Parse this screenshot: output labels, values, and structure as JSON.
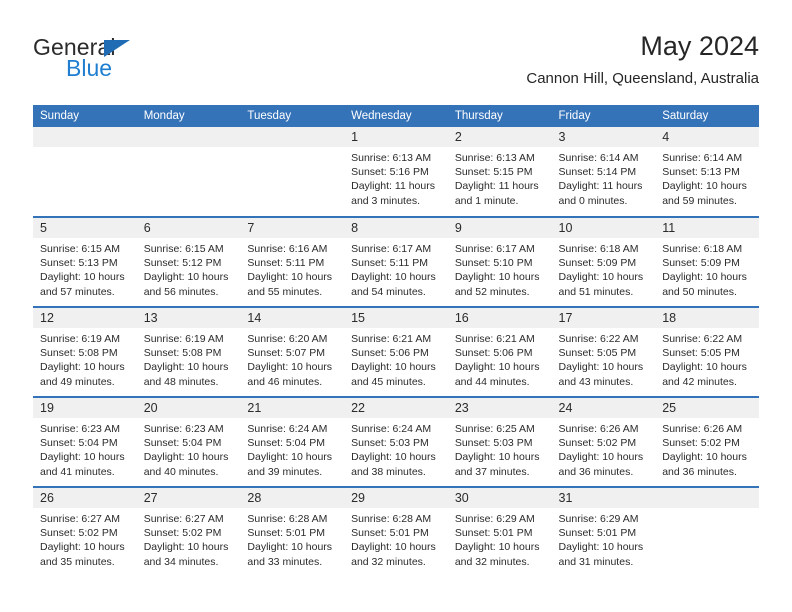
{
  "brand": {
    "name_top": "General",
    "name_bottom": "Blue"
  },
  "header": {
    "title": "May 2024",
    "subtitle": "Cannon Hill, Queensland, Australia"
  },
  "colors": {
    "header_blue": "#3573b9",
    "brand_blue": "#1f7ed0",
    "daynum_band": "#f0f0f0"
  },
  "weekday_headers": [
    "Sunday",
    "Monday",
    "Tuesday",
    "Wednesday",
    "Thursday",
    "Friday",
    "Saturday"
  ],
  "calendar_cells": [
    {
      "day": "",
      "sunrise": "",
      "sunset": "",
      "daylight_line1": "",
      "daylight_line2": "",
      "empty": true
    },
    {
      "day": "",
      "sunrise": "",
      "sunset": "",
      "daylight_line1": "",
      "daylight_line2": "",
      "empty": true
    },
    {
      "day": "",
      "sunrise": "",
      "sunset": "",
      "daylight_line1": "",
      "daylight_line2": "",
      "empty": true
    },
    {
      "day": "1",
      "sunrise": "Sunrise: 6:13 AM",
      "sunset": "Sunset: 5:16 PM",
      "daylight_line1": "Daylight: 11 hours",
      "daylight_line2": "and 3 minutes.",
      "empty": false
    },
    {
      "day": "2",
      "sunrise": "Sunrise: 6:13 AM",
      "sunset": "Sunset: 5:15 PM",
      "daylight_line1": "Daylight: 11 hours",
      "daylight_line2": "and 1 minute.",
      "empty": false
    },
    {
      "day": "3",
      "sunrise": "Sunrise: 6:14 AM",
      "sunset": "Sunset: 5:14 PM",
      "daylight_line1": "Daylight: 11 hours",
      "daylight_line2": "and 0 minutes.",
      "empty": false
    },
    {
      "day": "4",
      "sunrise": "Sunrise: 6:14 AM",
      "sunset": "Sunset: 5:13 PM",
      "daylight_line1": "Daylight: 10 hours",
      "daylight_line2": "and 59 minutes.",
      "empty": false
    },
    {
      "day": "5",
      "sunrise": "Sunrise: 6:15 AM",
      "sunset": "Sunset: 5:13 PM",
      "daylight_line1": "Daylight: 10 hours",
      "daylight_line2": "and 57 minutes.",
      "empty": false
    },
    {
      "day": "6",
      "sunrise": "Sunrise: 6:15 AM",
      "sunset": "Sunset: 5:12 PM",
      "daylight_line1": "Daylight: 10 hours",
      "daylight_line2": "and 56 minutes.",
      "empty": false
    },
    {
      "day": "7",
      "sunrise": "Sunrise: 6:16 AM",
      "sunset": "Sunset: 5:11 PM",
      "daylight_line1": "Daylight: 10 hours",
      "daylight_line2": "and 55 minutes.",
      "empty": false
    },
    {
      "day": "8",
      "sunrise": "Sunrise: 6:17 AM",
      "sunset": "Sunset: 5:11 PM",
      "daylight_line1": "Daylight: 10 hours",
      "daylight_line2": "and 54 minutes.",
      "empty": false
    },
    {
      "day": "9",
      "sunrise": "Sunrise: 6:17 AM",
      "sunset": "Sunset: 5:10 PM",
      "daylight_line1": "Daylight: 10 hours",
      "daylight_line2": "and 52 minutes.",
      "empty": false
    },
    {
      "day": "10",
      "sunrise": "Sunrise: 6:18 AM",
      "sunset": "Sunset: 5:09 PM",
      "daylight_line1": "Daylight: 10 hours",
      "daylight_line2": "and 51 minutes.",
      "empty": false
    },
    {
      "day": "11",
      "sunrise": "Sunrise: 6:18 AM",
      "sunset": "Sunset: 5:09 PM",
      "daylight_line1": "Daylight: 10 hours",
      "daylight_line2": "and 50 minutes.",
      "empty": false
    },
    {
      "day": "12",
      "sunrise": "Sunrise: 6:19 AM",
      "sunset": "Sunset: 5:08 PM",
      "daylight_line1": "Daylight: 10 hours",
      "daylight_line2": "and 49 minutes.",
      "empty": false
    },
    {
      "day": "13",
      "sunrise": "Sunrise: 6:19 AM",
      "sunset": "Sunset: 5:08 PM",
      "daylight_line1": "Daylight: 10 hours",
      "daylight_line2": "and 48 minutes.",
      "empty": false
    },
    {
      "day": "14",
      "sunrise": "Sunrise: 6:20 AM",
      "sunset": "Sunset: 5:07 PM",
      "daylight_line1": "Daylight: 10 hours",
      "daylight_line2": "and 46 minutes.",
      "empty": false
    },
    {
      "day": "15",
      "sunrise": "Sunrise: 6:21 AM",
      "sunset": "Sunset: 5:06 PM",
      "daylight_line1": "Daylight: 10 hours",
      "daylight_line2": "and 45 minutes.",
      "empty": false
    },
    {
      "day": "16",
      "sunrise": "Sunrise: 6:21 AM",
      "sunset": "Sunset: 5:06 PM",
      "daylight_line1": "Daylight: 10 hours",
      "daylight_line2": "and 44 minutes.",
      "empty": false
    },
    {
      "day": "17",
      "sunrise": "Sunrise: 6:22 AM",
      "sunset": "Sunset: 5:05 PM",
      "daylight_line1": "Daylight: 10 hours",
      "daylight_line2": "and 43 minutes.",
      "empty": false
    },
    {
      "day": "18",
      "sunrise": "Sunrise: 6:22 AM",
      "sunset": "Sunset: 5:05 PM",
      "daylight_line1": "Daylight: 10 hours",
      "daylight_line2": "and 42 minutes.",
      "empty": false
    },
    {
      "day": "19",
      "sunrise": "Sunrise: 6:23 AM",
      "sunset": "Sunset: 5:04 PM",
      "daylight_line1": "Daylight: 10 hours",
      "daylight_line2": "and 41 minutes.",
      "empty": false
    },
    {
      "day": "20",
      "sunrise": "Sunrise: 6:23 AM",
      "sunset": "Sunset: 5:04 PM",
      "daylight_line1": "Daylight: 10 hours",
      "daylight_line2": "and 40 minutes.",
      "empty": false
    },
    {
      "day": "21",
      "sunrise": "Sunrise: 6:24 AM",
      "sunset": "Sunset: 5:04 PM",
      "daylight_line1": "Daylight: 10 hours",
      "daylight_line2": "and 39 minutes.",
      "empty": false
    },
    {
      "day": "22",
      "sunrise": "Sunrise: 6:24 AM",
      "sunset": "Sunset: 5:03 PM",
      "daylight_line1": "Daylight: 10 hours",
      "daylight_line2": "and 38 minutes.",
      "empty": false
    },
    {
      "day": "23",
      "sunrise": "Sunrise: 6:25 AM",
      "sunset": "Sunset: 5:03 PM",
      "daylight_line1": "Daylight: 10 hours",
      "daylight_line2": "and 37 minutes.",
      "empty": false
    },
    {
      "day": "24",
      "sunrise": "Sunrise: 6:26 AM",
      "sunset": "Sunset: 5:02 PM",
      "daylight_line1": "Daylight: 10 hours",
      "daylight_line2": "and 36 minutes.",
      "empty": false
    },
    {
      "day": "25",
      "sunrise": "Sunrise: 6:26 AM",
      "sunset": "Sunset: 5:02 PM",
      "daylight_line1": "Daylight: 10 hours",
      "daylight_line2": "and 36 minutes.",
      "empty": false
    },
    {
      "day": "26",
      "sunrise": "Sunrise: 6:27 AM",
      "sunset": "Sunset: 5:02 PM",
      "daylight_line1": "Daylight: 10 hours",
      "daylight_line2": "and 35 minutes.",
      "empty": false
    },
    {
      "day": "27",
      "sunrise": "Sunrise: 6:27 AM",
      "sunset": "Sunset: 5:02 PM",
      "daylight_line1": "Daylight: 10 hours",
      "daylight_line2": "and 34 minutes.",
      "empty": false
    },
    {
      "day": "28",
      "sunrise": "Sunrise: 6:28 AM",
      "sunset": "Sunset: 5:01 PM",
      "daylight_line1": "Daylight: 10 hours",
      "daylight_line2": "and 33 minutes.",
      "empty": false
    },
    {
      "day": "29",
      "sunrise": "Sunrise: 6:28 AM",
      "sunset": "Sunset: 5:01 PM",
      "daylight_line1": "Daylight: 10 hours",
      "daylight_line2": "and 32 minutes.",
      "empty": false
    },
    {
      "day": "30",
      "sunrise": "Sunrise: 6:29 AM",
      "sunset": "Sunset: 5:01 PM",
      "daylight_line1": "Daylight: 10 hours",
      "daylight_line2": "and 32 minutes.",
      "empty": false
    },
    {
      "day": "31",
      "sunrise": "Sunrise: 6:29 AM",
      "sunset": "Sunset: 5:01 PM",
      "daylight_line1": "Daylight: 10 hours",
      "daylight_line2": "and 31 minutes.",
      "empty": false
    },
    {
      "day": "",
      "sunrise": "",
      "sunset": "",
      "daylight_line1": "",
      "daylight_line2": "",
      "empty": true
    }
  ]
}
